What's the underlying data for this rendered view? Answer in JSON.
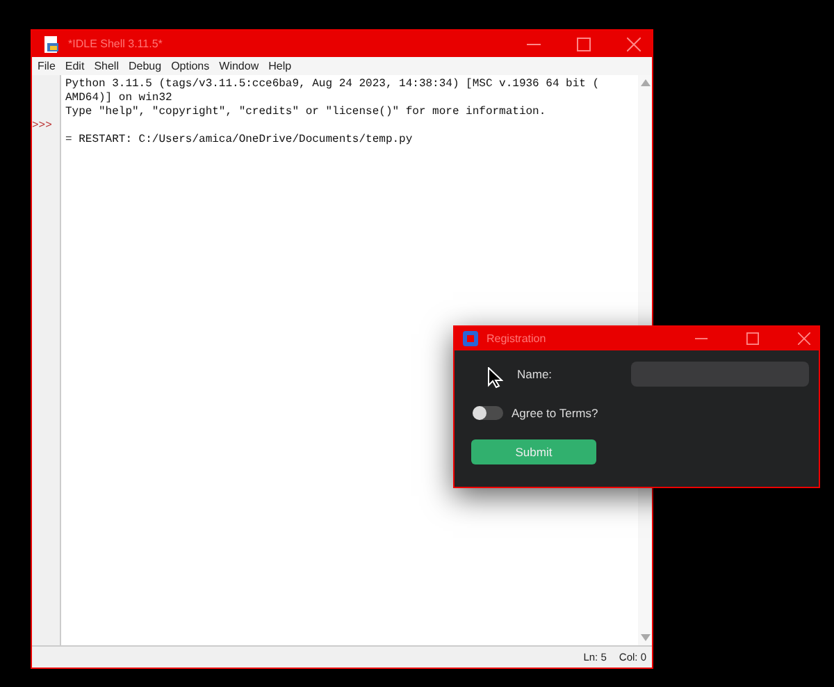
{
  "shell_window": {
    "title": "*IDLE Shell 3.11.5*",
    "menu": [
      "File",
      "Edit",
      "Shell",
      "Debug",
      "Options",
      "Window",
      "Help"
    ],
    "lines": [
      {
        "text": "Python 3.11.5 (tags/v3.11.5:cce6ba9, Aug 24 2023, 14:38:34) [MSC v.1936 64 bit ("
      },
      {
        "text": "AMD64)] on win32"
      },
      {
        "text": "Type \"help\", \"copyright\", \"credits\" or \"license()\" for more information."
      },
      {
        "prompt": ">>>"
      },
      {
        "text": "= RESTART: C:/Users/amica/OneDrive/Documents/temp.py"
      }
    ],
    "status_bar": [
      "Ln: 5",
      "Col: 0"
    ]
  },
  "registration_window": {
    "title": "Registration",
    "name_label": "Name:",
    "terms": {
      "label": "Agree to Terms?",
      "on": false
    },
    "submit": "Submit"
  }
}
